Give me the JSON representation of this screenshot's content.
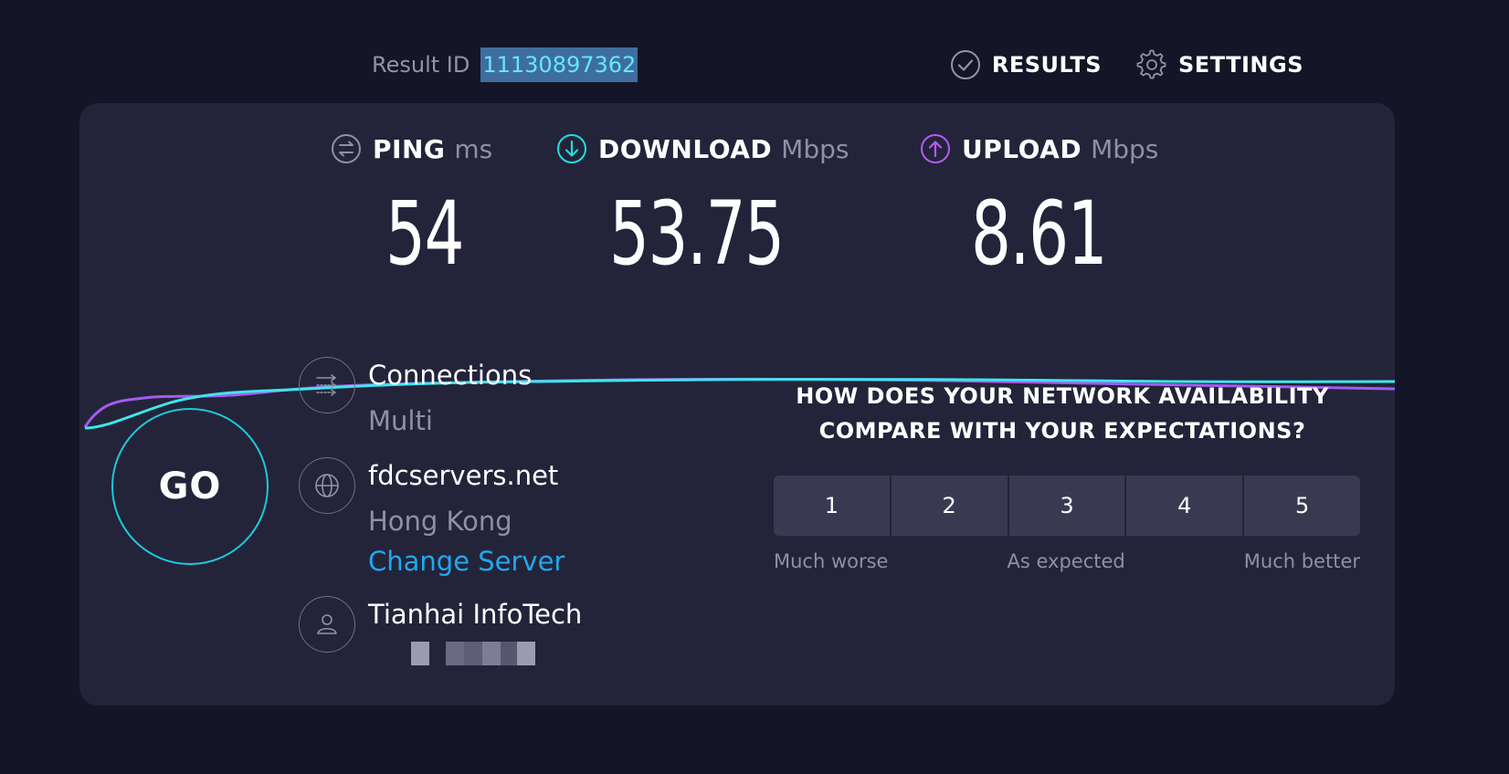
{
  "header": {
    "result_id_label": "Result ID",
    "result_id_value": "11130897362",
    "nav": [
      {
        "label": "RESULTS",
        "icon": "check-circle-icon"
      },
      {
        "label": "SETTINGS",
        "icon": "gear-icon"
      }
    ]
  },
  "metrics": {
    "ping": {
      "label": "PING",
      "unit": "ms",
      "value": "54",
      "icon": "ping-icon",
      "color": "#8e90a6"
    },
    "download": {
      "label": "DOWNLOAD",
      "unit": "Mbps",
      "value": "53.75",
      "icon": "download-arrow-icon",
      "color": "#1ee0e0"
    },
    "upload": {
      "label": "UPLOAD",
      "unit": "Mbps",
      "value": "8.61",
      "icon": "upload-arrow-icon",
      "color": "#b45cf2"
    }
  },
  "graph": {
    "download_color": "#3ee6ec",
    "upload_color": "#a55bf0"
  },
  "go_button": {
    "label": "GO"
  },
  "connections": {
    "title": "Connections",
    "value": "Multi",
    "icon": "connections-icon"
  },
  "server": {
    "title": "fdcservers.net",
    "location": "Hong Kong",
    "change_link": "Change Server",
    "icon": "globe-icon"
  },
  "provider": {
    "title": "Tianhai InfoTech",
    "icon": "user-icon",
    "redacted_ip": true
  },
  "survey": {
    "question_line1": "HOW DOES YOUR NETWORK AVAILABILITY",
    "question_line2": "COMPARE WITH YOUR EXPECTATIONS?",
    "options": [
      "1",
      "2",
      "3",
      "4",
      "5"
    ],
    "label_low": "Much worse",
    "label_mid": "As expected",
    "label_high": "Much better"
  },
  "colors": {
    "background": "#141526",
    "panel": "#23243a",
    "accent_cyan": "#1ec8d8",
    "link_blue": "#21a8f0"
  }
}
